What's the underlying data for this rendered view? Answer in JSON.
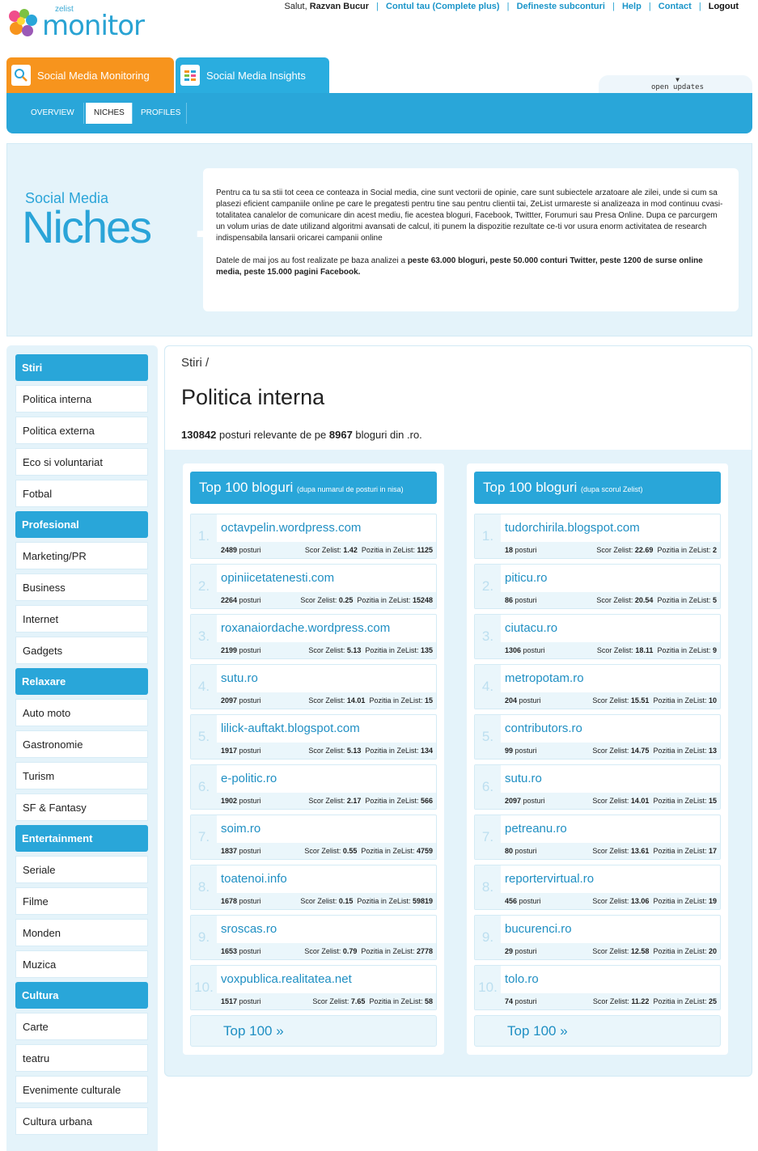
{
  "brand": {
    "small": "zelist",
    "name": "monitor"
  },
  "toplinks": {
    "greeting": "Salut,",
    "user": "Razvan Bucur",
    "account": "Contul tau (Complete plus)",
    "subaccounts": "Defineste subconturi",
    "help": "Help",
    "contact": "Contact",
    "logout": "Logout"
  },
  "tabs": [
    {
      "label": "Social Media Monitoring",
      "icon": "magnifier-chart-icon"
    },
    {
      "label": "Social Media Insights",
      "icon": "bars-grid-icon"
    }
  ],
  "open_updates": "open updates",
  "subnav": [
    "OVERVIEW",
    "NICHES",
    "PROFILES"
  ],
  "hero": {
    "subtitle": "Social Media",
    "title": "Niches",
    "paragraph1": "Pentru ca tu sa stii tot ceea ce conteaza in Social media, cine sunt vectorii de opinie, care sunt subiectele arzatoare ale zilei, unde si cum sa plasezi eficient campaniile online pe care le pregatesti pentru tine sau pentru clientii tai, ZeList urmareste si analizeaza in mod continuu cvasi-totalitatea canalelor de comunicare din acest mediu, fie acestea bloguri, Facebook, Twittter, Forumuri sau Presa Online. Dupa ce parcurgem un volum urias de date utilizand algoritmi avansati de calcul, iti punem la dispozitie rezultate ce-ti vor usura enorm activitatea de research indispensabila lansarii oricarei campanii online",
    "paragraph2_prefix": "Datele de mai jos au fost realizate pe baza analizei a ",
    "paragraph2_bold": "peste 63.000 bloguri, peste 50.000 conturi Twitter, peste 1200 de surse online media, peste 15.000 pagini Facebook."
  },
  "sidebar": [
    {
      "category": "Stiri",
      "items": [
        "Politica interna",
        "Politica externa",
        "Eco si voluntariat",
        "Fotbal"
      ]
    },
    {
      "category": "Profesional",
      "items": [
        "Marketing/PR",
        "Business",
        "Internet",
        "Gadgets"
      ]
    },
    {
      "category": "Relaxare",
      "items": [
        "Auto moto",
        "Gastronomie",
        "Turism",
        "SF & Fantasy"
      ]
    },
    {
      "category": "Entertainment",
      "items": [
        "Seriale",
        "Filme",
        "Monden",
        "Muzica"
      ]
    },
    {
      "category": "Cultura",
      "items": [
        "Carte",
        "teatru",
        "Evenimente culturale",
        "Cultura urbana"
      ]
    }
  ],
  "main": {
    "breadcrumb": "Stiri /",
    "title": "Politica interna",
    "count_posts": "130842",
    "count_mid": " posturi relevante de pe ",
    "count_blogs": "8967",
    "count_suffix": " bloguri din .ro."
  },
  "columns": [
    {
      "title": "Top 100 bloguri",
      "subtitle": "(dupa numarul de posturi in nisa)",
      "more": "Top 100 »",
      "entries": [
        {
          "url": "octavpelin.wordpress.com",
          "posts": "2489",
          "score": "1.42",
          "pos": "1125"
        },
        {
          "url": "opiniicetatenesti.com",
          "posts": "2264",
          "score": "0.25",
          "pos": "15248"
        },
        {
          "url": "roxanaiordache.wordpress.com",
          "posts": "2199",
          "score": "5.13",
          "pos": "135"
        },
        {
          "url": "sutu.ro",
          "posts": "2097",
          "score": "14.01",
          "pos": "15"
        },
        {
          "url": "lilick-auftakt.blogspot.com",
          "posts": "1917",
          "score": "5.13",
          "pos": "134"
        },
        {
          "url": "e-politic.ro",
          "posts": "1902",
          "score": "2.17",
          "pos": "566"
        },
        {
          "url": "soim.ro",
          "posts": "1837",
          "score": "0.55",
          "pos": "4759"
        },
        {
          "url": "toatenoi.info",
          "posts": "1678",
          "score": "0.15",
          "pos": "59819"
        },
        {
          "url": "sroscas.ro",
          "posts": "1653",
          "score": "0.79",
          "pos": "2778"
        },
        {
          "url": "voxpublica.realitatea.net",
          "posts": "1517",
          "score": "7.65",
          "pos": "58"
        }
      ]
    },
    {
      "title": "Top 100 bloguri",
      "subtitle": "(dupa scorul Zelist)",
      "more": "Top 100 »",
      "entries": [
        {
          "url": "tudorchirila.blogspot.com",
          "posts": "18",
          "score": "22.69",
          "pos": "2"
        },
        {
          "url": "piticu.ro",
          "posts": "86",
          "score": "20.54",
          "pos": "5"
        },
        {
          "url": "ciutacu.ro",
          "posts": "1306",
          "score": "18.11",
          "pos": "9"
        },
        {
          "url": "metropotam.ro",
          "posts": "204",
          "score": "15.51",
          "pos": "10"
        },
        {
          "url": "contributors.ro",
          "posts": "99",
          "score": "14.75",
          "pos": "13"
        },
        {
          "url": "sutu.ro",
          "posts": "2097",
          "score": "14.01",
          "pos": "15"
        },
        {
          "url": "petreanu.ro",
          "posts": "80",
          "score": "13.61",
          "pos": "17"
        },
        {
          "url": "reportervirtual.ro",
          "posts": "456",
          "score": "13.06",
          "pos": "19"
        },
        {
          "url": "bucurenci.ro",
          "posts": "29",
          "score": "12.58",
          "pos": "20"
        },
        {
          "url": "tolo.ro",
          "posts": "74",
          "score": "11.22",
          "pos": "25"
        }
      ]
    }
  ],
  "labels": {
    "posts": "posturi",
    "score": "Scor Zelist:",
    "position": "Pozitia in ZeList:"
  }
}
